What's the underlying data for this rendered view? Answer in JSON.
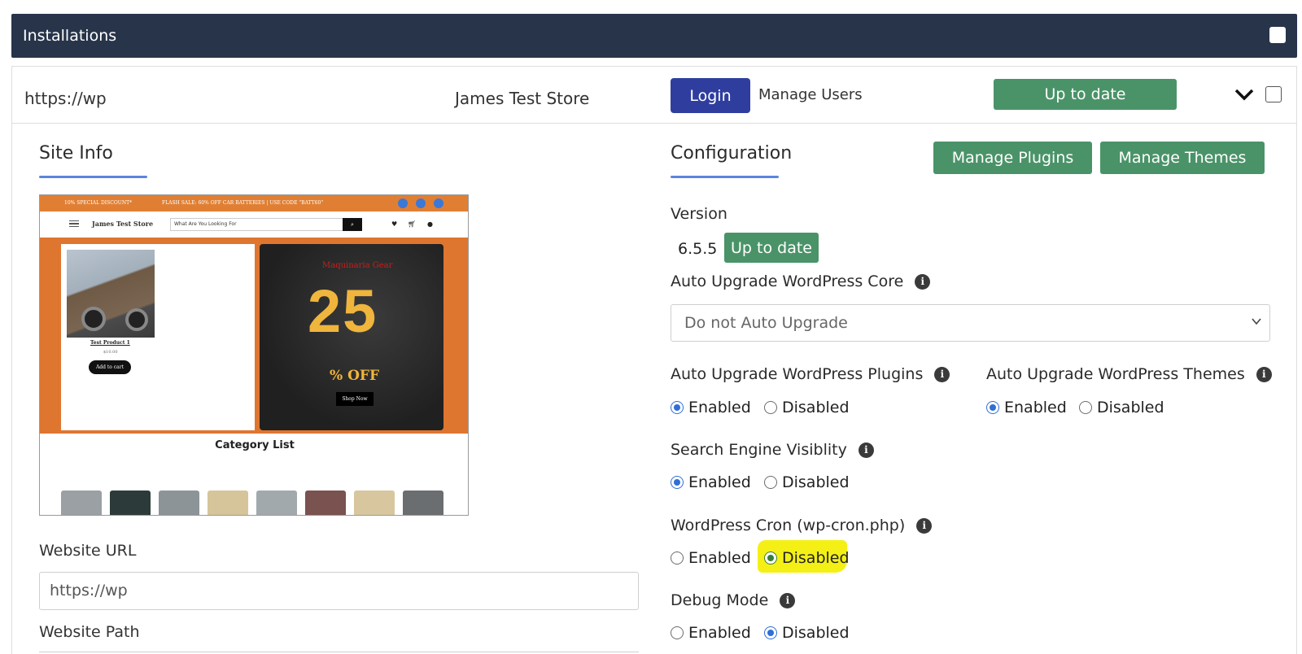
{
  "header": {
    "title": "Installations"
  },
  "installation": {
    "url": "https://wp",
    "site_name": "James Test Store",
    "login_label": "Login",
    "manage_users_label": "Manage Users",
    "status_label": "Up to date"
  },
  "site_info": {
    "title": "Site Info",
    "preview": {
      "promo_left": "10% SPECIAL DISCOUNT*",
      "promo_center": "FLASH SALE: 60% OFF CAR BATTERIES | USE CODE \"BATT60\"",
      "store_name": "James Test Store",
      "search_placeholder": "What Are You Looking For",
      "product_name": "Test Product 1",
      "product_price": "$10.00",
      "add_to_cart": "Add to cart",
      "brand": "Maquinaria Gear",
      "sale_number": "25",
      "sale_text": "% OFF",
      "shop_now": "Shop Now",
      "category_title": "Category List"
    },
    "website_url_label": "Website URL",
    "website_url_value": "https://wp",
    "website_path_label": "Website Path"
  },
  "configuration": {
    "title": "Configuration",
    "manage_plugins_label": "Manage Plugins",
    "manage_themes_label": "Manage Themes",
    "version_label": "Version",
    "version_value": "6.5.5",
    "version_status": "Up to date",
    "auto_core_label": "Auto Upgrade WordPress Core",
    "auto_core_value": "Do not Auto Upgrade",
    "auto_plugins_label": "Auto Upgrade WordPress Plugins",
    "auto_themes_label": "Auto Upgrade WordPress Themes",
    "search_visibility_label": "Search Engine Visiblity",
    "cron_label": "WordPress Cron (wp-cron.php)",
    "debug_label": "Debug Mode",
    "enabled": "Enabled",
    "disabled": "Disabled",
    "selected": {
      "auto_plugins": "Enabled",
      "auto_themes": "Enabled",
      "search_visibility": "Enabled",
      "cron": "Disabled",
      "debug": "Disabled"
    }
  },
  "colors": {
    "header_bg": "#27344a",
    "login_blue": "#2f3e9e",
    "success_green": "#4a9368",
    "accent_underline": "#5b84de",
    "highlight_yellow": "#f4f016"
  }
}
